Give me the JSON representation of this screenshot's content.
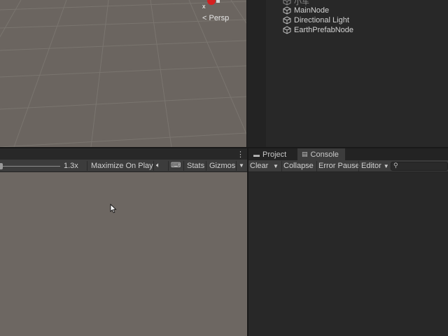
{
  "scene": {
    "projection_label": "< Persp",
    "gizmo_axis": "x",
    "colors": {
      "background": "#6b6560",
      "grid": "#7d7873",
      "gizmo": "#d42020"
    }
  },
  "hierarchy": {
    "items": [
      {
        "label": "小车",
        "icon": "gameobject-cube-icon",
        "faded": true
      },
      {
        "label": "MainNode",
        "icon": "gameobject-cube-icon"
      },
      {
        "label": "Directional Light",
        "icon": "gameobject-cube-icon"
      },
      {
        "label": "EarthPrefabNode",
        "icon": "gameobject-cube-icon"
      }
    ]
  },
  "game": {
    "scale_value": "1.3x",
    "maximize_on_play": "Maximize On Play",
    "mute_icon": "speaker-icon",
    "keyboard_icon": "keyboard-icon",
    "stats": "Stats",
    "gizmos": "Gizmos",
    "more_icon": "kebab-menu-icon"
  },
  "console_panel": {
    "tabs": [
      {
        "label": "Project",
        "icon": "folder-icon"
      },
      {
        "label": "Console",
        "icon": "console-icon",
        "active": true
      }
    ],
    "toolbar": {
      "clear": "Clear",
      "collapse": "Collapse",
      "error_pause": "Error Pause",
      "editor": "Editor",
      "search_placeholder": ""
    }
  }
}
